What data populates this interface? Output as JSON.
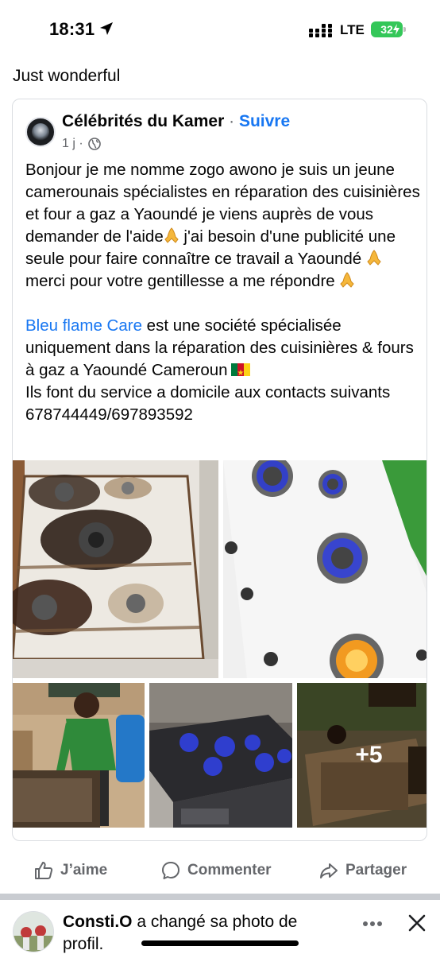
{
  "status_bar": {
    "time": "18:31",
    "network": "LTE",
    "battery": "32"
  },
  "post": {
    "caption": "Just wonderful"
  },
  "shared_post": {
    "page_name": "Célébrités du Kamer",
    "separator": "·",
    "follow_label": "Suivre",
    "time": "1 j ·",
    "audience_icon": "globe-icon",
    "paragraph1": {
      "part1": "Bonjour je me nomme zogo awono je suis un jeune camerounais spécialistes en réparation des cuisinières et four a gaz a Yaoundé je viens auprès de vous demander de l'aide",
      "part2": " j'ai besoin d'une publicité une seule pour faire connaître ce travail a Yaoundé ",
      "part3": " merci pour votre gentillesse a me répondre "
    },
    "paragraph2": {
      "link": "Bleu flame Care",
      "text1": " est une société spécialisée uniquement dans la réparation des cuisinières & fours à  gaz a Yaoundé Cameroun",
      "line2": "Ils font du service a domicile aux contacts suivants 678744449/697893592"
    },
    "more_photos": "+5"
  },
  "actions": {
    "like": "J’aime",
    "comment": "Commenter",
    "share": "Partager"
  },
  "next_item": {
    "name": "Consti.O",
    "text": " a changé sa photo de profil."
  },
  "colors": {
    "accent": "#1877f2",
    "muted": "#65676b",
    "battery": "#34c759"
  }
}
